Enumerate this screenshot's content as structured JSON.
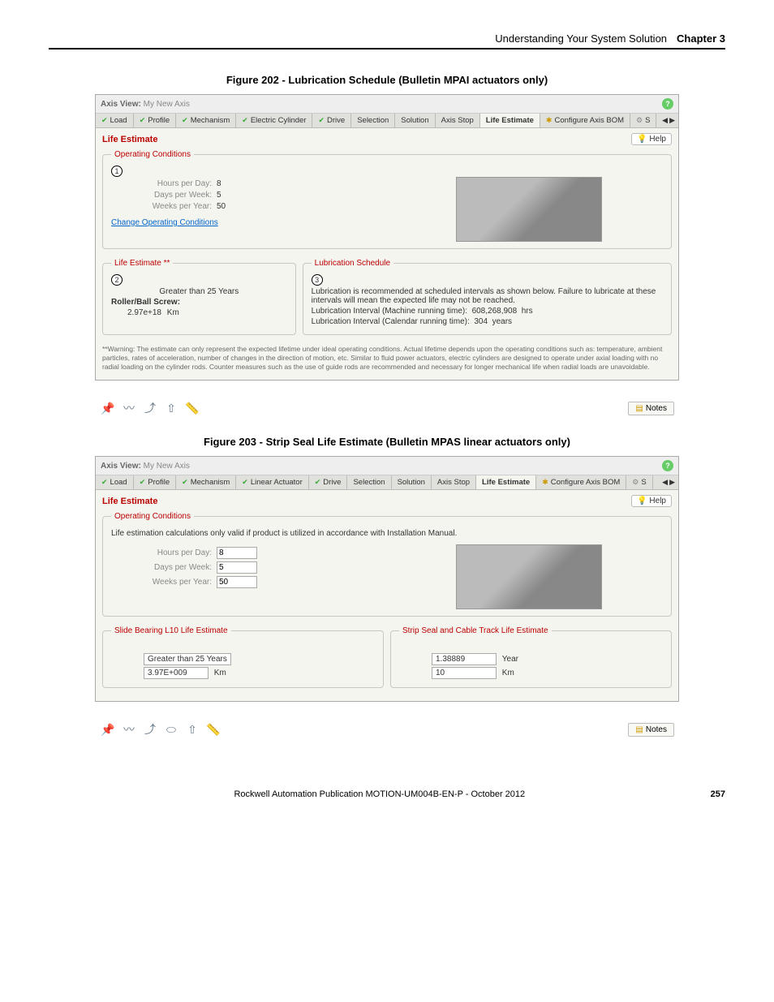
{
  "header": {
    "section": "Understanding Your System Solution",
    "chapter": "Chapter 3"
  },
  "figure202": {
    "title": "Figure 202 - Lubrication Schedule (Bulletin MPAI actuators only)",
    "axisViewLabel": "Axis View:",
    "axisName": "My New Axis",
    "tabs": {
      "load": "Load",
      "profile": "Profile",
      "mechanism": "Mechanism",
      "electricCylinder": "Electric Cylinder",
      "drive": "Drive",
      "selection": "Selection",
      "solution": "Solution",
      "axisStop": "Axis Stop",
      "lifeEstimate": "Life Estimate",
      "configureBOM": "Configure Axis BOM",
      "extra": "S"
    },
    "panelTitle": "Life Estimate",
    "helpLabel": "Help",
    "operating": {
      "legend": "Operating Conditions",
      "hoursPerDayLabel": "Hours per Day:",
      "hoursPerDay": "8",
      "daysPerWeekLabel": "Days per Week:",
      "daysPerWeek": "5",
      "weeksPerYearLabel": "Weeks per Year:",
      "weeksPerYear": "50",
      "changeLink": "Change Operating Conditions"
    },
    "lifeEstimate": {
      "legend": "Life Estimate **",
      "gt25": "Greater than 25 Years",
      "rollerLabel": "Roller/Ball Screw:",
      "value": "2.97e+18",
      "unit": "Km"
    },
    "lubrication": {
      "legend": "Lubrication Schedule",
      "note": "Lubrication is recommended at scheduled intervals as shown below. Failure to lubricate at these intervals will mean the expected life may not be reached.",
      "machineLabel": "Lubrication Interval (Machine running time):",
      "machineVal": "608,268,908",
      "machineUnit": "hrs",
      "calendarLabel": "Lubrication Interval (Calendar running time):",
      "calendarVal": "304",
      "calendarUnit": "years"
    },
    "warning": "**Warning: The estimate can only represent the expected lifetime under ideal operating conditions. Actual lifetime depends upon the operating conditions such as: temperature, ambient particles, rates of acceleration, number of changes in the direction of motion, etc. Similar to fluid power actuators, electric cylinders are designed to operate under axial loading with no radial loading on the cylinder rods. Counter measures such as the use of guide rods are recommended and necessary for longer mechanical life when radial loads are unavoidable.",
    "notesLabel": "Notes"
  },
  "figure203": {
    "title": "Figure 203 - Strip Seal Life Estimate (Bulletin MPAS linear actuators only)",
    "axisViewLabel": "Axis View:",
    "axisName": "My New Axis",
    "tabs": {
      "load": "Load",
      "profile": "Profile",
      "mechanism": "Mechanism",
      "linearActuator": "Linear Actuator",
      "drive": "Drive",
      "selection": "Selection",
      "solution": "Solution",
      "axisStop": "Axis Stop",
      "lifeEstimate": "Life Estimate",
      "configureBOM": "Configure Axis BOM",
      "extra": "S"
    },
    "panelTitle": "Life Estimate",
    "helpLabel": "Help",
    "operating": {
      "legend": "Operating Conditions",
      "note": "Life estimation calculations only valid if product is utilized in accordance with Installation Manual.",
      "hoursPerDayLabel": "Hours per Day:",
      "hoursPerDay": "8",
      "daysPerWeekLabel": "Days per Week:",
      "daysPerWeek": "5",
      "weeksPerYearLabel": "Weeks per Year:",
      "weeksPerYear": "50"
    },
    "slideBearing": {
      "legend": "Slide Bearing L10 Life Estimate",
      "gt25": "Greater than 25 Years",
      "value": "3.97E+009",
      "unit": "Km"
    },
    "stripSeal": {
      "legend": "Strip Seal and Cable Track Life Estimate",
      "year": "1.38889",
      "yearUnit": "Year",
      "km": "10",
      "kmUnit": "Km"
    },
    "notesLabel": "Notes"
  },
  "footer": {
    "pub": "Rockwell Automation Publication MOTION-UM004B-EN-P - October 2012",
    "page": "257"
  }
}
